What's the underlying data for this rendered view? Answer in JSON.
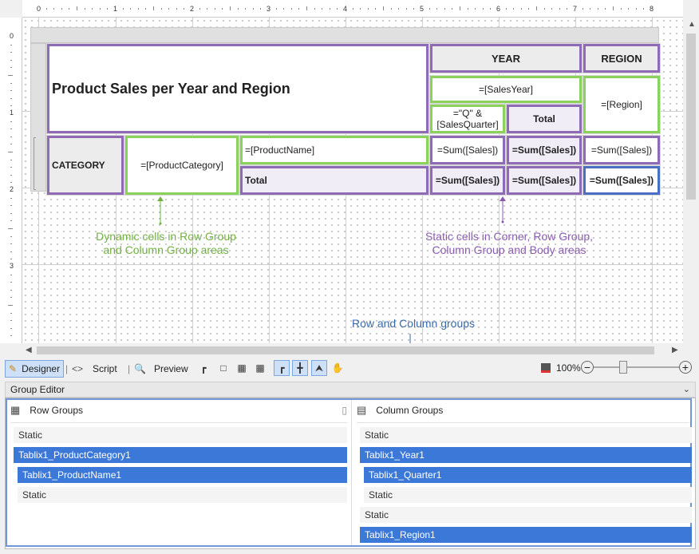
{
  "ruler": {
    "h_numbers": [
      "0",
      "1",
      "2",
      "3",
      "4",
      "5",
      "6",
      "7",
      "8"
    ],
    "v_numbers": [
      "0",
      "1",
      "2",
      "3"
    ]
  },
  "tablix": {
    "title": "Product Sales per Year and Region",
    "year_header": "YEAR",
    "region_header": "REGION",
    "sales_year": "=[SalesYear]",
    "region_expr": "=[Region]",
    "quarter_expr": "=\"Q\" & [SalesQuarter]",
    "total_col": "Total",
    "category_header": "CATEGORY",
    "product_category": "=[ProductCategory]",
    "product_name": "=[ProductName]",
    "total_row": "Total",
    "sum_sales": "=Sum([Sales])",
    "sum_sales_bold": "=Sum([Sales])"
  },
  "annotations": {
    "dynamic": "Dynamic cells in Row Group\nand Column Group areas",
    "static": "Static cells in Corner, Row Group,\nColumn Group and Body areas",
    "groups": "Row and Column groups"
  },
  "toolbar": {
    "designer": "Designer",
    "script": "Script",
    "preview": "Preview",
    "zoom": "100%"
  },
  "group_editor": {
    "title": "Group Editor",
    "row_groups_label": "Row Groups",
    "column_groups_label": "Column Groups",
    "row_groups": [
      {
        "label": "Static",
        "kind": "static",
        "indent": 0
      },
      {
        "label": "Tablix1_ProductCategory1",
        "kind": "selected",
        "indent": 0
      },
      {
        "label": "Tablix1_ProductName1",
        "kind": "selected",
        "indent": 1
      },
      {
        "label": "Static",
        "kind": "static",
        "indent": 1
      }
    ],
    "column_groups": [
      {
        "label": "Static",
        "kind": "static",
        "indent": 0
      },
      {
        "label": "Tablix1_Year1",
        "kind": "selected",
        "indent": 0
      },
      {
        "label": "Tablix1_Quarter1",
        "kind": "selected",
        "indent": 1
      },
      {
        "label": "Static",
        "kind": "static",
        "indent": 1
      },
      {
        "label": "Static",
        "kind": "static",
        "indent": 0
      },
      {
        "label": "Tablix1_Region1",
        "kind": "selected",
        "indent": 0
      }
    ]
  },
  "colors": {
    "purple": "#8f6bb6",
    "green": "#8bd25c",
    "blue": "#4a6fc3",
    "selection": "#3b78d8"
  }
}
